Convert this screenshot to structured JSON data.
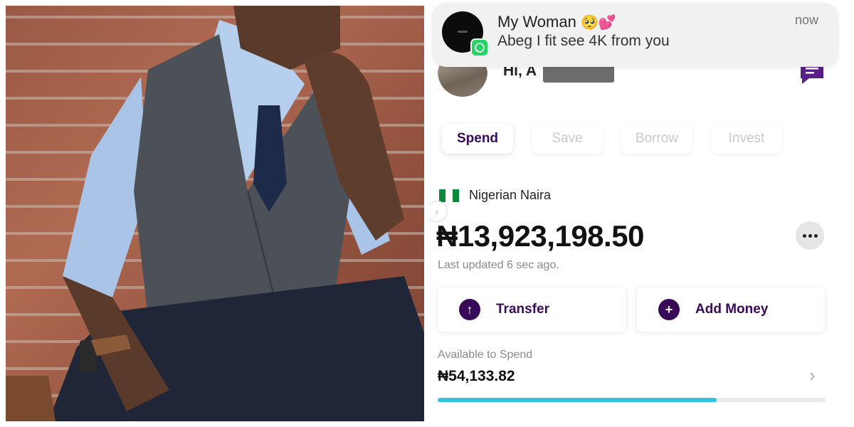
{
  "notification": {
    "sender": "My Woman",
    "sender_emojis": "🥺💕",
    "message": "Abeg I fit see 4K from you",
    "time": "now",
    "app_badge_icon": "whatsapp-icon"
  },
  "header": {
    "greeting": "Hi, A"
  },
  "tabs": [
    {
      "label": "Spend",
      "active": true
    },
    {
      "label": "Save",
      "active": false
    },
    {
      "label": "Borrow",
      "active": false
    },
    {
      "label": "Invest",
      "active": false
    }
  ],
  "account": {
    "currency_label": "Nigerian Naira",
    "flag_colors": [
      "#0a8a3a",
      "#ffffff",
      "#0a8a3a"
    ],
    "balance": "₦13,923,198.50",
    "last_updated": "Last updated 6 sec ago."
  },
  "actions": {
    "transfer_label": "Transfer",
    "add_money_label": "Add Money"
  },
  "spend": {
    "available_label": "Available to Spend",
    "available_value": "₦54,133.82",
    "progress_fraction": 0.72
  },
  "colors": {
    "brand_purple": "#3a0a5a",
    "progress_blue": "#34c3df",
    "whatsapp_green": "#25d366"
  }
}
